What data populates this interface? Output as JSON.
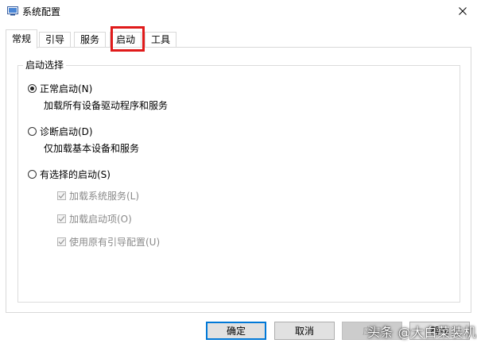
{
  "window": {
    "title": "系统配置"
  },
  "tabs": [
    {
      "label": "常规",
      "active": true
    },
    {
      "label": "引导",
      "active": false
    },
    {
      "label": "服务",
      "active": false
    },
    {
      "label": "启动",
      "active": false,
      "highlighted": true
    },
    {
      "label": "工具",
      "active": false
    }
  ],
  "startup_selection": {
    "legend": "启动选择",
    "options": [
      {
        "label": "正常启动(N)",
        "description": "加载所有设备驱动程序和服务",
        "selected": true
      },
      {
        "label": "诊断启动(D)",
        "description": "仅加载基本设备和服务",
        "selected": false
      },
      {
        "label": "有选择的启动(S)",
        "description": "",
        "selected": false
      }
    ],
    "selective_items": [
      {
        "label": "加载系统服务(L)",
        "checked": true,
        "enabled": false
      },
      {
        "label": "加载启动项(O)",
        "checked": true,
        "enabled": false
      },
      {
        "label": "使用原有引导配置(U)",
        "checked": true,
        "enabled": false
      }
    ]
  },
  "buttons": {
    "ok": "确定",
    "cancel": "取消",
    "apply": "应用",
    "help": "帮助"
  },
  "watermark": "头条 @大白菜装机",
  "colors": {
    "highlight": "#e01a1a",
    "default_button_border": "#0078d7"
  }
}
